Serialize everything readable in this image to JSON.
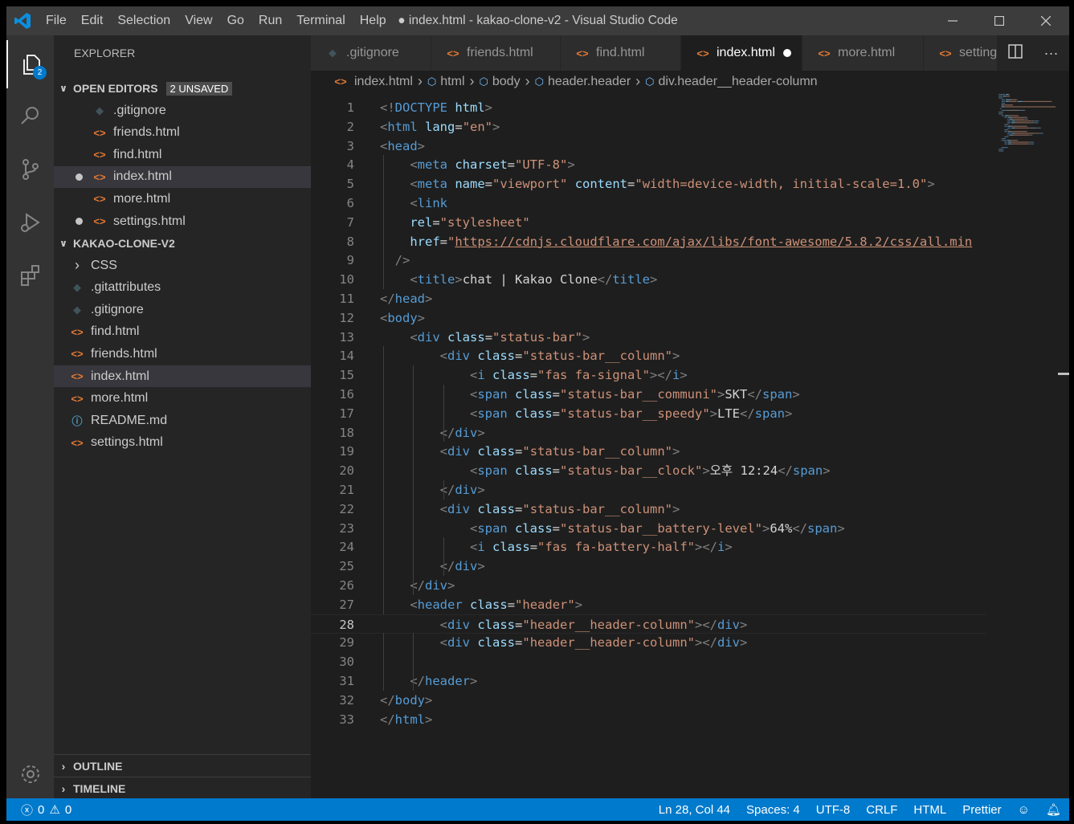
{
  "titlebar": {
    "menu": [
      "File",
      "Edit",
      "Selection",
      "View",
      "Go",
      "Run",
      "Terminal",
      "Help"
    ],
    "window_title": "● index.html - kakao-clone-v2 - Visual Studio Code"
  },
  "activitybar": {
    "explorer_badge": "2"
  },
  "sidebar": {
    "title": "EXPLORER",
    "open_editors": {
      "label": "OPEN EDITORS",
      "badge": "2 UNSAVED",
      "items": [
        {
          "label": ".gitignore",
          "icon": "git-icon",
          "glyph": "◆"
        },
        {
          "label": "friends.html",
          "icon": "html-icon",
          "glyph": "<>"
        },
        {
          "label": "find.html",
          "icon": "html-icon",
          "glyph": "<>"
        },
        {
          "label": "index.html",
          "icon": "html-icon",
          "glyph": "<>"
        },
        {
          "label": "more.html",
          "icon": "html-icon",
          "glyph": "<>"
        },
        {
          "label": "settings.html",
          "icon": "html-icon",
          "glyph": "<>"
        }
      ]
    },
    "project": {
      "label": "KAKAO-CLONE-V2",
      "items": [
        {
          "label": "CSS",
          "icon": "chevron-right-icon",
          "glyph": "›"
        },
        {
          "label": ".gitattributes",
          "icon": "git-icon",
          "glyph": "◆"
        },
        {
          "label": ".gitignore",
          "icon": "git-icon",
          "glyph": "◆"
        },
        {
          "label": "find.html",
          "icon": "html-icon",
          "glyph": "<>"
        },
        {
          "label": "friends.html",
          "icon": "html-icon",
          "glyph": "<>"
        },
        {
          "label": "index.html",
          "icon": "html-icon",
          "glyph": "<>"
        },
        {
          "label": "more.html",
          "icon": "html-icon",
          "glyph": "<>"
        },
        {
          "label": "README.md",
          "icon": "info-icon",
          "glyph": "ⓘ"
        },
        {
          "label": "settings.html",
          "icon": "html-icon",
          "glyph": "<>"
        }
      ]
    },
    "outline": "OUTLINE",
    "timeline": "TIMELINE"
  },
  "tabs": [
    {
      "label": ".gitignore",
      "icon": "git-icon",
      "glyph": "◆"
    },
    {
      "label": "friends.html",
      "icon": "html-icon",
      "glyph": "<>"
    },
    {
      "label": "find.html",
      "icon": "html-icon",
      "glyph": "<>"
    },
    {
      "label": "index.html",
      "icon": "html-icon",
      "glyph": "<>"
    },
    {
      "label": "more.html",
      "icon": "html-icon",
      "glyph": "<>"
    },
    {
      "label": "setting",
      "icon": "html-icon",
      "glyph": "<>"
    }
  ],
  "breadcrumbs": [
    "index.html",
    "html",
    "body",
    "header.header",
    "div.header__header-column"
  ],
  "editor": {
    "lines": [
      [
        [
          "p",
          "<!"
        ],
        [
          "t",
          "DOCTYPE"
        ],
        [
          "x",
          " "
        ],
        [
          "a",
          "html"
        ],
        [
          "p",
          ">"
        ]
      ],
      [
        [
          "p",
          "<"
        ],
        [
          "t",
          "html"
        ],
        [
          "x",
          " "
        ],
        [
          "a",
          "lang"
        ],
        [
          "x",
          "="
        ],
        [
          "s",
          "\"en\""
        ],
        [
          "p",
          ">"
        ]
      ],
      [
        [
          "p",
          "<"
        ],
        [
          "t",
          "head"
        ],
        [
          "p",
          ">"
        ]
      ],
      [
        [
          "x",
          "    "
        ],
        [
          "p",
          "<"
        ],
        [
          "t",
          "meta"
        ],
        [
          "x",
          " "
        ],
        [
          "a",
          "charset"
        ],
        [
          "x",
          "="
        ],
        [
          "s",
          "\"UTF-8\""
        ],
        [
          "p",
          ">"
        ]
      ],
      [
        [
          "x",
          "    "
        ],
        [
          "p",
          "<"
        ],
        [
          "t",
          "meta"
        ],
        [
          "x",
          " "
        ],
        [
          "a",
          "name"
        ],
        [
          "x",
          "="
        ],
        [
          "s",
          "\"viewport\""
        ],
        [
          "x",
          " "
        ],
        [
          "a",
          "content"
        ],
        [
          "x",
          "="
        ],
        [
          "s",
          "\"width=device-width, initial-scale=1.0\""
        ],
        [
          "p",
          ">"
        ]
      ],
      [
        [
          "x",
          "    "
        ],
        [
          "p",
          "<"
        ],
        [
          "t",
          "link"
        ]
      ],
      [
        [
          "x",
          "    "
        ],
        [
          "a",
          "rel"
        ],
        [
          "x",
          "="
        ],
        [
          "s",
          "\"stylesheet\""
        ]
      ],
      [
        [
          "x",
          "    "
        ],
        [
          "a",
          "href"
        ],
        [
          "x",
          "="
        ],
        [
          "s",
          "\""
        ],
        [
          "u",
          "https://cdnjs.cloudflare.com/ajax/libs/font-awesome/5.8.2/css/all.min"
        ]
      ],
      [
        [
          "x",
          "  "
        ],
        [
          "p",
          "/>"
        ]
      ],
      [
        [
          "x",
          "    "
        ],
        [
          "p",
          "<"
        ],
        [
          "t",
          "title"
        ],
        [
          "p",
          ">"
        ],
        [
          "x",
          "chat | Kakao Clone"
        ],
        [
          "p",
          "</"
        ],
        [
          "t",
          "title"
        ],
        [
          "p",
          ">"
        ]
      ],
      [
        [
          "p",
          "</"
        ],
        [
          "t",
          "head"
        ],
        [
          "p",
          ">"
        ]
      ],
      [
        [
          "p",
          "<"
        ],
        [
          "t",
          "body"
        ],
        [
          "p",
          ">"
        ]
      ],
      [
        [
          "x",
          "    "
        ],
        [
          "p",
          "<"
        ],
        [
          "t",
          "div"
        ],
        [
          "x",
          " "
        ],
        [
          "a",
          "class"
        ],
        [
          "x",
          "="
        ],
        [
          "s",
          "\"status-bar\""
        ],
        [
          "p",
          ">"
        ]
      ],
      [
        [
          "x",
          "        "
        ],
        [
          "p",
          "<"
        ],
        [
          "t",
          "div"
        ],
        [
          "x",
          " "
        ],
        [
          "a",
          "class"
        ],
        [
          "x",
          "="
        ],
        [
          "s",
          "\"status-bar__column\""
        ],
        [
          "p",
          ">"
        ]
      ],
      [
        [
          "x",
          "            "
        ],
        [
          "p",
          "<"
        ],
        [
          "t",
          "i"
        ],
        [
          "x",
          " "
        ],
        [
          "a",
          "class"
        ],
        [
          "x",
          "="
        ],
        [
          "s",
          "\"fas fa-signal\""
        ],
        [
          "p",
          "></"
        ],
        [
          "t",
          "i"
        ],
        [
          "p",
          ">"
        ]
      ],
      [
        [
          "x",
          "            "
        ],
        [
          "p",
          "<"
        ],
        [
          "t",
          "span"
        ],
        [
          "x",
          " "
        ],
        [
          "a",
          "class"
        ],
        [
          "x",
          "="
        ],
        [
          "s",
          "\"status-bar__communi\""
        ],
        [
          "p",
          ">"
        ],
        [
          "x",
          "SKT"
        ],
        [
          "p",
          "</"
        ],
        [
          "t",
          "span"
        ],
        [
          "p",
          ">"
        ]
      ],
      [
        [
          "x",
          "            "
        ],
        [
          "p",
          "<"
        ],
        [
          "t",
          "span"
        ],
        [
          "x",
          " "
        ],
        [
          "a",
          "class"
        ],
        [
          "x",
          "="
        ],
        [
          "s",
          "\"status-bar__speedy\""
        ],
        [
          "p",
          ">"
        ],
        [
          "x",
          "LTE"
        ],
        [
          "p",
          "</"
        ],
        [
          "t",
          "span"
        ],
        [
          "p",
          ">"
        ]
      ],
      [
        [
          "x",
          "        "
        ],
        [
          "p",
          "</"
        ],
        [
          "t",
          "div"
        ],
        [
          "p",
          ">"
        ]
      ],
      [
        [
          "x",
          "        "
        ],
        [
          "p",
          "<"
        ],
        [
          "t",
          "div"
        ],
        [
          "x",
          " "
        ],
        [
          "a",
          "class"
        ],
        [
          "x",
          "="
        ],
        [
          "s",
          "\"status-bar__column\""
        ],
        [
          "p",
          ">"
        ]
      ],
      [
        [
          "x",
          "            "
        ],
        [
          "p",
          "<"
        ],
        [
          "t",
          "span"
        ],
        [
          "x",
          " "
        ],
        [
          "a",
          "class"
        ],
        [
          "x",
          "="
        ],
        [
          "s",
          "\"status-bar__clock\""
        ],
        [
          "p",
          ">"
        ],
        [
          "x",
          "오후 12:24"
        ],
        [
          "p",
          "</"
        ],
        [
          "t",
          "span"
        ],
        [
          "p",
          ">"
        ]
      ],
      [
        [
          "x",
          "        "
        ],
        [
          "p",
          "</"
        ],
        [
          "t",
          "div"
        ],
        [
          "p",
          ">"
        ]
      ],
      [
        [
          "x",
          "        "
        ],
        [
          "p",
          "<"
        ],
        [
          "t",
          "div"
        ],
        [
          "x",
          " "
        ],
        [
          "a",
          "class"
        ],
        [
          "x",
          "="
        ],
        [
          "s",
          "\"status-bar__column\""
        ],
        [
          "p",
          ">"
        ]
      ],
      [
        [
          "x",
          "            "
        ],
        [
          "p",
          "<"
        ],
        [
          "t",
          "span"
        ],
        [
          "x",
          " "
        ],
        [
          "a",
          "class"
        ],
        [
          "x",
          "="
        ],
        [
          "s",
          "\"status-bar__battery-level\""
        ],
        [
          "p",
          ">"
        ],
        [
          "x",
          "64%"
        ],
        [
          "p",
          "</"
        ],
        [
          "t",
          "span"
        ],
        [
          "p",
          ">"
        ]
      ],
      [
        [
          "x",
          "            "
        ],
        [
          "p",
          "<"
        ],
        [
          "t",
          "i"
        ],
        [
          "x",
          " "
        ],
        [
          "a",
          "class"
        ],
        [
          "x",
          "="
        ],
        [
          "s",
          "\"fas fa-battery-half\""
        ],
        [
          "p",
          "></"
        ],
        [
          "t",
          "i"
        ],
        [
          "p",
          ">"
        ]
      ],
      [
        [
          "x",
          "        "
        ],
        [
          "p",
          "</"
        ],
        [
          "t",
          "div"
        ],
        [
          "p",
          ">"
        ]
      ],
      [
        [
          "x",
          "    "
        ],
        [
          "p",
          "</"
        ],
        [
          "t",
          "div"
        ],
        [
          "p",
          ">"
        ]
      ],
      [
        [
          "x",
          "    "
        ],
        [
          "p",
          "<"
        ],
        [
          "t",
          "header"
        ],
        [
          "x",
          " "
        ],
        [
          "a",
          "class"
        ],
        [
          "x",
          "="
        ],
        [
          "s",
          "\"header\""
        ],
        [
          "p",
          ">"
        ]
      ],
      [
        [
          "x",
          "        "
        ],
        [
          "p",
          "<"
        ],
        [
          "t",
          "div"
        ],
        [
          "x",
          " "
        ],
        [
          "a",
          "class"
        ],
        [
          "x",
          "="
        ],
        [
          "s",
          "\"header__header-column\""
        ],
        [
          "p",
          "></"
        ],
        [
          "t",
          "div"
        ],
        [
          "p",
          ">"
        ]
      ],
      [
        [
          "x",
          "        "
        ],
        [
          "p",
          "<"
        ],
        [
          "t",
          "div"
        ],
        [
          "x",
          " "
        ],
        [
          "a",
          "class"
        ],
        [
          "x",
          "="
        ],
        [
          "s",
          "\"header__header-column\""
        ],
        [
          "p",
          "></"
        ],
        [
          "t",
          "div"
        ],
        [
          "p",
          ">"
        ]
      ],
      [
        [
          "x",
          ""
        ]
      ],
      [
        [
          "x",
          "    "
        ],
        [
          "p",
          "</"
        ],
        [
          "t",
          "header"
        ],
        [
          "p",
          ">"
        ]
      ],
      [
        [
          "p",
          "</"
        ],
        [
          "t",
          "body"
        ],
        [
          "p",
          ">"
        ]
      ],
      [
        [
          "p",
          "</"
        ],
        [
          "t",
          "html"
        ],
        [
          "p",
          ">"
        ]
      ]
    ]
  },
  "statusbar": {
    "errors": "0",
    "warnings": "0",
    "position": "Ln 28, Col 44",
    "spaces": "Spaces: 4",
    "encoding": "UTF-8",
    "eol": "CRLF",
    "language": "HTML",
    "formatter": "Prettier"
  },
  "colors": {
    "accent": "#007acc",
    "html_icon": "#e37933",
    "tag": "#569cd6",
    "attribute": "#9cdcfe",
    "string": "#ce9178"
  }
}
